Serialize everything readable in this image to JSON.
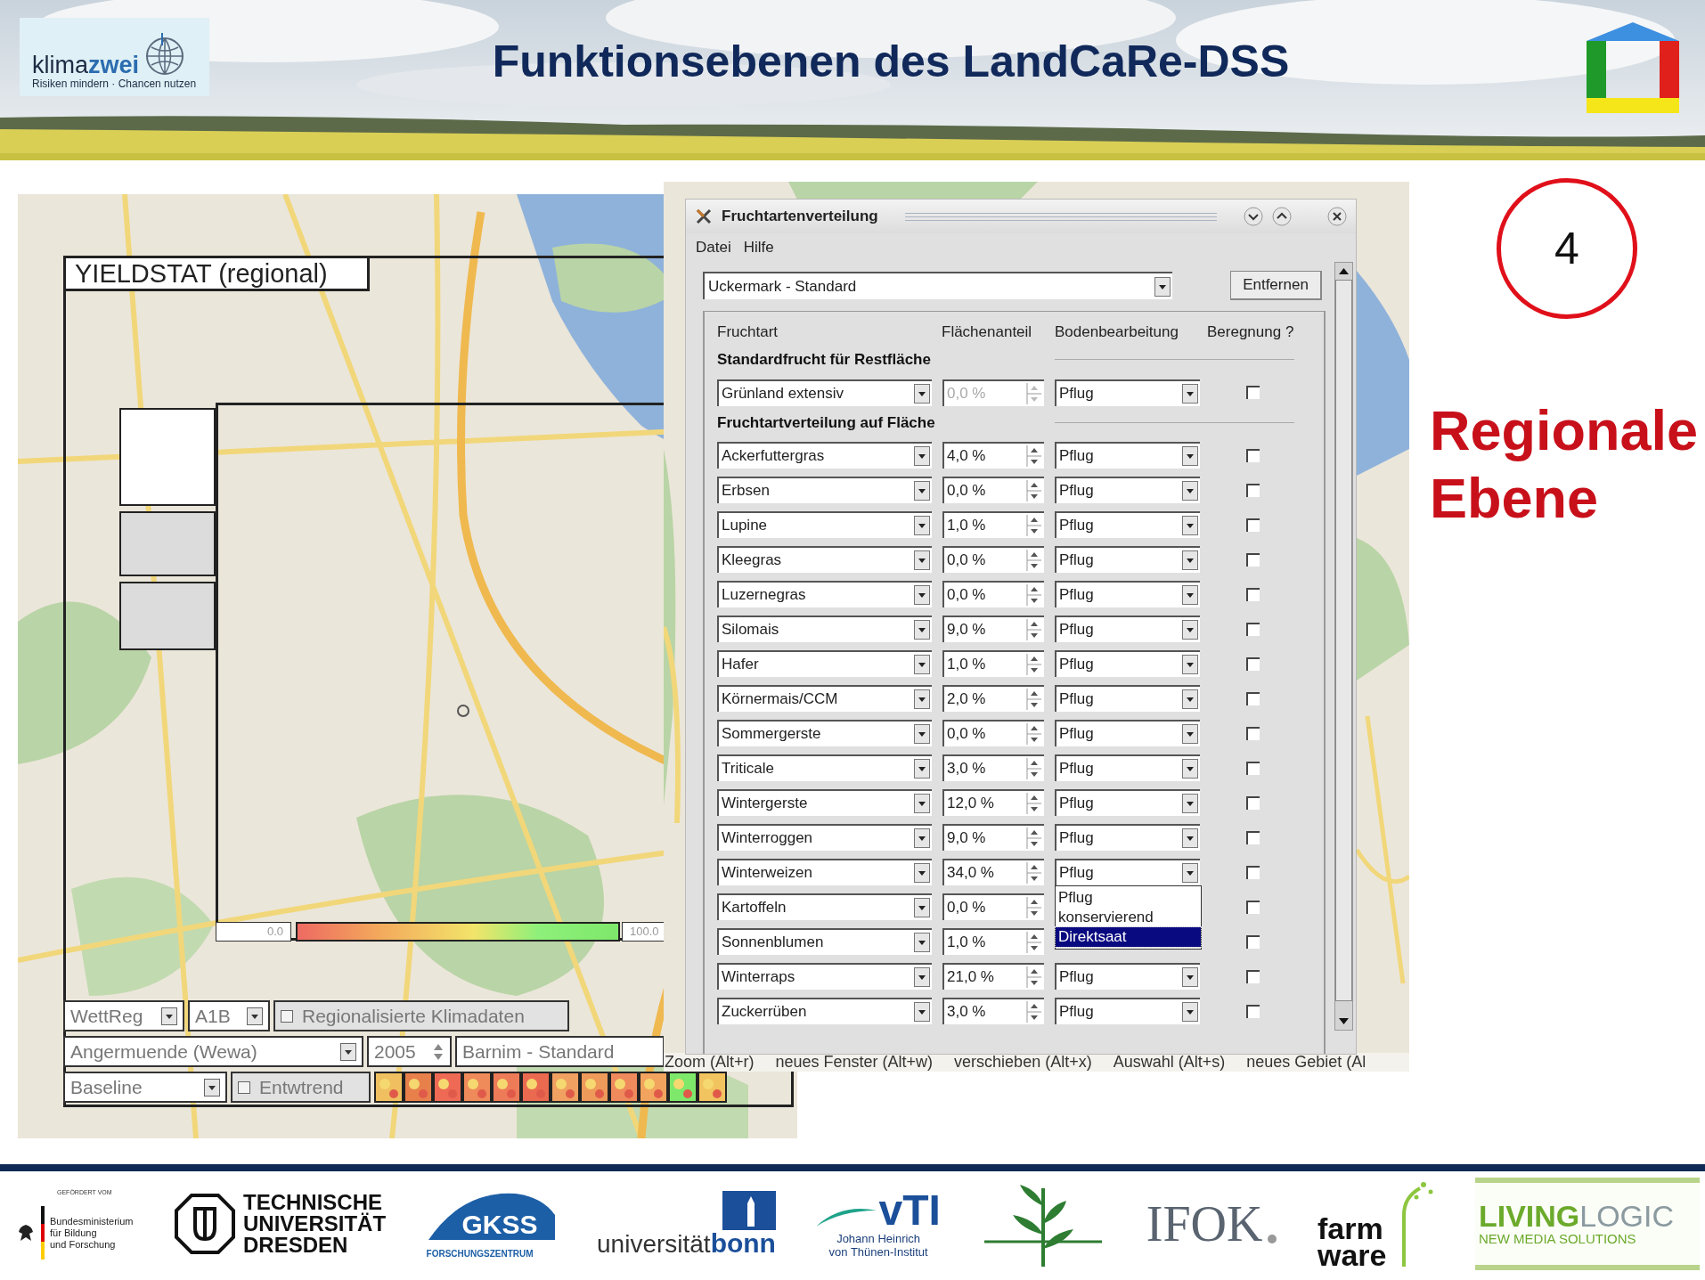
{
  "header": {
    "title": "Funktionsebenen des LandCaRe-DSS",
    "logo": {
      "wordmark": "klima**zwei**",
      "tagline": "Risiken mindern · Chancen nutzen"
    }
  },
  "map_panel": {
    "title": "YIELDSTAT (regional)",
    "scale_min": "0.0",
    "scale_max": "100.0",
    "climate_model": "WettReg",
    "scenario": "A1B",
    "regional_data": {
      "label": "Regionalisierte Klimadaten",
      "checked": false
    },
    "station": "Angermuende (Wewa)",
    "year": "2005",
    "profile": "Barnim - Standard",
    "period": "Baseline",
    "detrend": {
      "label": "Entwtrend",
      "checked": false
    }
  },
  "dialog": {
    "title": "Fruchtartenverteilung",
    "menu": [
      "Datei",
      "Hilfe"
    ],
    "scenario": "Uckermark - Standard",
    "remove_button": "Entfernen",
    "columns": [
      "Fruchtart",
      "Flächenanteil",
      "Bodenbearbeitung",
      "Beregnung ?"
    ],
    "standard_heading": "Standardfrucht für Restfläche",
    "standard_row": {
      "crop": "Grünland extensiv",
      "share": "0,0 %",
      "share_disabled": true,
      "tillage": "Pflug",
      "irrigated": false
    },
    "distribution_heading": "Fruchtartverteilung auf Fläche",
    "rows": [
      {
        "crop": "Ackerfuttergras",
        "share": "4,0 %",
        "share_disabled": false,
        "tillage": "Pflug",
        "irrigated": false
      },
      {
        "crop": "Erbsen",
        "share": "0,0 %",
        "share_disabled": false,
        "tillage": "Pflug",
        "irrigated": false
      },
      {
        "crop": "Lupine",
        "share": "1,0 %",
        "share_disabled": false,
        "tillage": "Pflug",
        "irrigated": false
      },
      {
        "crop": "Kleegras",
        "share": "0,0 %",
        "share_disabled": false,
        "tillage": "Pflug",
        "irrigated": false
      },
      {
        "crop": "Luzernegras",
        "share": "0,0 %",
        "share_disabled": false,
        "tillage": "Pflug",
        "irrigated": false
      },
      {
        "crop": "Silomais",
        "share": "9,0 %",
        "share_disabled": false,
        "tillage": "Pflug",
        "irrigated": false
      },
      {
        "crop": "Hafer",
        "share": "1,0 %",
        "share_disabled": false,
        "tillage": "Pflug",
        "irrigated": false
      },
      {
        "crop": "Körnermais/CCM",
        "share": "2,0 %",
        "share_disabled": false,
        "tillage": "Pflug",
        "irrigated": false
      },
      {
        "crop": "Sommergerste",
        "share": "0,0 %",
        "share_disabled": false,
        "tillage": "Pflug",
        "irrigated": false
      },
      {
        "crop": "Triticale",
        "share": "3,0 %",
        "share_disabled": false,
        "tillage": "Pflug",
        "irrigated": false
      },
      {
        "crop": "Wintergerste",
        "share": "12,0 %",
        "share_disabled": false,
        "tillage": "Pflug",
        "irrigated": false
      },
      {
        "crop": "Winterroggen",
        "share": "9,0 %",
        "share_disabled": false,
        "tillage": "Pflug",
        "irrigated": false
      },
      {
        "crop": "Winterweizen",
        "share": "34,0 %",
        "share_disabled": false,
        "tillage": "Pflug",
        "irrigated": false,
        "tillage_menu": [
          {
            "label": "Pflug",
            "selected": false
          },
          {
            "label": "konservierend",
            "selected": false
          },
          {
            "label": "Direktsaat",
            "selected": true
          }
        ]
      },
      {
        "crop": "Kartoffeln",
        "share": "0,0 %",
        "share_disabled": false,
        "irrigated": false
      },
      {
        "crop": "Sonnenblumen",
        "share": "1,0 %",
        "share_disabled": false,
        "irrigated": false
      },
      {
        "crop": "Winterraps",
        "share": "21,0 %",
        "share_disabled": false,
        "tillage": "Pflug",
        "irrigated": false
      },
      {
        "crop": "Zuckerrüben",
        "share": "3,0 %",
        "share_disabled": false,
        "tillage": "Pflug",
        "irrigated": false
      }
    ]
  },
  "status_hints": [
    "Zoom (Alt+r)",
    "neues Fenster (Alt+w)",
    "verschieben (Alt+x)",
    "Auswahl (Alt+s)",
    "neues Gebiet (Al"
  ],
  "level_number": "4",
  "level_title": "Regionale Ebene",
  "sponsors": [
    {
      "kind": "ministry",
      "eyebrow": "GEFÖRDERT VOM",
      "lines": [
        "Bundesministerium",
        "für Bildung",
        "und Forschung"
      ]
    },
    {
      "kind": "university_dresden",
      "lines": [
        "TECHNISCHE",
        "UNIVERSITÄT",
        "DRESDEN"
      ]
    },
    {
      "kind": "research_center",
      "lines": [
        "GKSS",
        "FORSCHUNGSZENTRUM"
      ]
    },
    {
      "kind": "university_bonn",
      "lines": [
        "universität",
        "bonn"
      ]
    },
    {
      "kind": "institute",
      "lines": [
        "vTI",
        "Johann Heinrich",
        "von Thünen-Institut"
      ]
    },
    {
      "kind": "plant_mark"
    },
    {
      "kind": "wordmark",
      "lines": [
        "IFOK"
      ]
    },
    {
      "kind": "sprout",
      "lines": [
        "farm",
        "ware"
      ]
    },
    {
      "kind": "media",
      "lines": [
        "**LIVING**LOGIC",
        "NEW MEDIA SOLUTIONS"
      ]
    }
  ]
}
